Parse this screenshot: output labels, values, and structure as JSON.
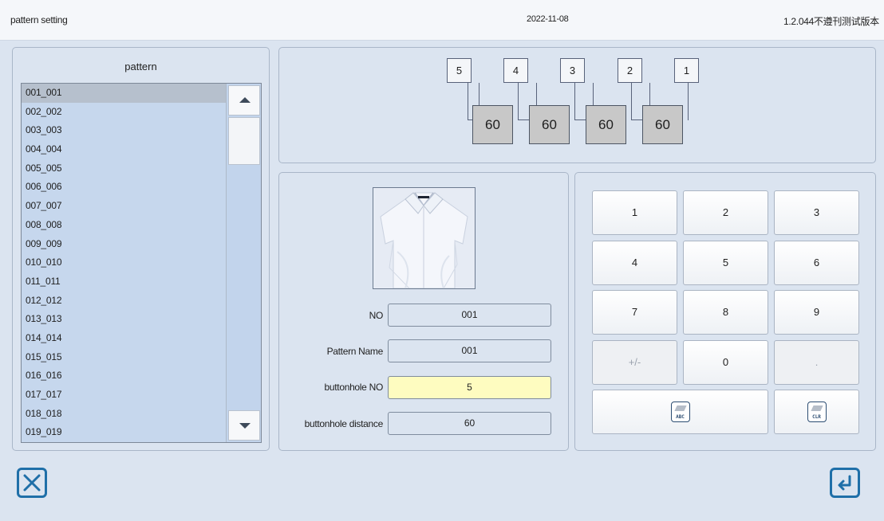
{
  "header": {
    "title": "pattern setting",
    "date": "2022-11-08",
    "version": "1.2.044不遵刊测试版本"
  },
  "pattern_list": {
    "title": "pattern",
    "selected_index": 0,
    "items": [
      "001_001",
      "002_002",
      "003_003",
      "004_004",
      "005_005",
      "006_006",
      "007_007",
      "008_008",
      "009_009",
      "010_010",
      "011_011",
      "012_012",
      "013_013",
      "014_014",
      "015_015",
      "016_016",
      "017_017",
      "018_018",
      "019_019"
    ]
  },
  "buttonhole_sequence": {
    "numbers": [
      "5",
      "4",
      "3",
      "2",
      "1"
    ],
    "distances": [
      "60",
      "60",
      "60",
      "60"
    ]
  },
  "form": {
    "no_label": "NO",
    "no_value": "001",
    "name_label": "Pattern Name",
    "name_value": "001",
    "buttonhole_no_label": "buttonhole NO",
    "buttonhole_no_value": "5",
    "distance_label": "buttonhole distance",
    "distance_value": "60"
  },
  "keypad": {
    "keys": [
      "1",
      "2",
      "3",
      "4",
      "5",
      "6",
      "7",
      "8",
      "9",
      "+/-",
      "0",
      "."
    ],
    "abc_label": "ABC",
    "clr_label": "CLR"
  },
  "colors": {
    "background": "#dbe4f0",
    "active_field": "#fefcc0",
    "icon_blue": "#1f6fa8"
  }
}
